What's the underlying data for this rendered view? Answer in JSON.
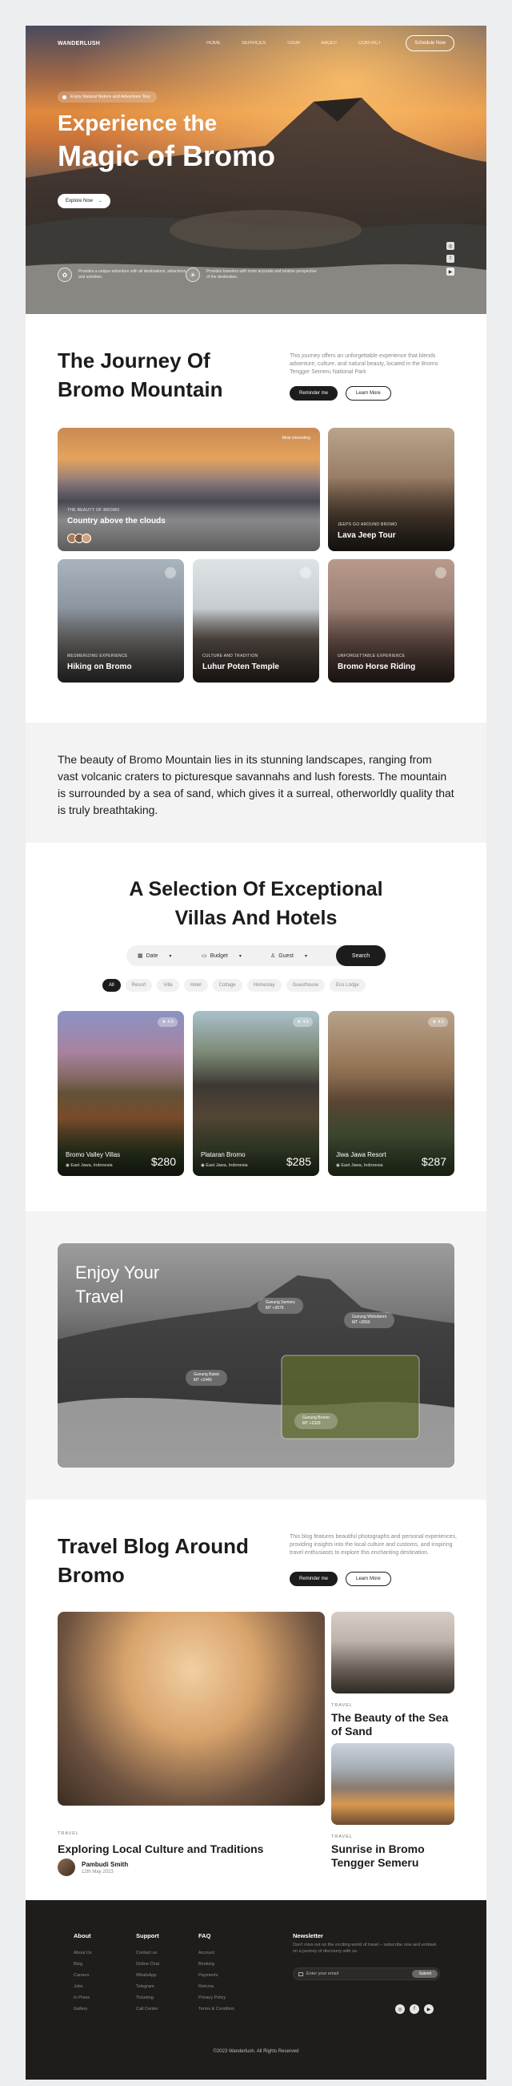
{
  "nav": {
    "logo": "WANDERLUSH",
    "links": [
      "HOME",
      "SERVICES",
      "TOUR",
      "ABOUT",
      "CONTACT"
    ],
    "cta": "Schedule Now"
  },
  "hero": {
    "badge": "Enjoy Natural Nature and Adventure Tour",
    "title_line1": "Experience the",
    "title_line2": "Magic of Bromo",
    "explore": "Explore Now",
    "features": [
      {
        "icon": "leaf-icon",
        "text": "Provides a unique adventure with all destinations, attractions, and activities."
      },
      {
        "icon": "sun-icon",
        "text": "Provides travelers with more accurate and relative perspective of the destination."
      }
    ]
  },
  "journey": {
    "title": "The Journey Of Bromo Mountain",
    "description": "This journey offers an unforgettable experience that blends adventure, culture, and natural beauty, located in the Bromo Tengger Semeru National Park",
    "btn_primary": "Reminder me",
    "btn_secondary": "Learn More",
    "cards": [
      {
        "kicker": "THE BEAUTY OF BROMO",
        "title": "Country above the clouds",
        "tag": "Most interesting"
      },
      {
        "kicker": "JEEPS GO AROUND BROMO",
        "title": "Lava Jeep Tour"
      },
      {
        "kicker": "MESMERIZING EXPERIENCE",
        "title": "Hiking on Bromo"
      },
      {
        "kicker": "CULTURE AND TRADITION",
        "title": "Luhur Poten Temple"
      },
      {
        "kicker": "UNFORGETTABLE EXPERIENCE",
        "title": "Bromo Horse Riding"
      }
    ]
  },
  "quote": {
    "text": "The beauty of Bromo Mountain lies in its stunning landscapes, ranging from vast volcanic craters to picturesque savannahs and lush forests. The mountain is surrounded by a sea of sand, which gives it a surreal, otherworldly quality that is truly breathtaking."
  },
  "villas": {
    "title_line1": "A Selection Of Exceptional",
    "title_line2": "Villas And Hotels",
    "search": {
      "date": "Date",
      "budget": "Budget",
      "guest": "Guest",
      "button": "Search"
    },
    "filters": [
      "All",
      "Resort",
      "Villa",
      "Hotel",
      "Cottage",
      "Homestay",
      "Guesthouse",
      "Eco Lodge"
    ],
    "cards": [
      {
        "name": "Bromo Valley Villas",
        "location": "East Jawa, Indonesia",
        "price": "$280",
        "rating": "4.5"
      },
      {
        "name": "Plataran Bromo",
        "location": "East Jawa, Indonesia",
        "price": "$285",
        "rating": "4.5"
      },
      {
        "name": "Jiwa Jawa Resort",
        "location": "East Jawa, Indonesia",
        "price": "$287",
        "rating": "4.5"
      }
    ]
  },
  "enjoy": {
    "title_line1": "Enjoy Your",
    "title_line2": "Travel",
    "pins": [
      {
        "name": "Gunung Semeru",
        "height": "MT +3676"
      },
      {
        "name": "Gunung Widodaren",
        "height": "MT +2650"
      },
      {
        "name": "Gunung Batok",
        "height": "MT +2440"
      },
      {
        "name": "Gunung Bromo",
        "height": "MT +2329"
      }
    ]
  },
  "blog": {
    "title": "Travel Blog Around Bromo",
    "description": "This blog features beautiful photographs and personal experiences, providing insights into the local culture and customs, and inspiring travel enthusiasts to explore this enchanting destination.",
    "btn_primary": "Reminder me",
    "btn_secondary": "Learn More",
    "main": {
      "kicker": "TRAVEL",
      "title": "Exploring Local Culture and Traditions",
      "author": "Pambudi Smith",
      "date": "12th May 2023"
    },
    "side": [
      {
        "kicker": "TRAVEL",
        "title": "The Beauty of the Sea of Sand"
      },
      {
        "kicker": "TRAVEL",
        "title": "Sunrise in Bromo Tengger Semeru"
      }
    ]
  },
  "footer": {
    "columns": [
      {
        "heading": "About",
        "items": [
          "About Us",
          "Blog",
          "Careers",
          "Jobs",
          "In Press",
          "Gallery"
        ]
      },
      {
        "heading": "Support",
        "items": [
          "Contact us",
          "Online Chat",
          "WhatsApp",
          "Telegram",
          "Ticketing",
          "Call Center"
        ]
      },
      {
        "heading": "FAQ",
        "items": [
          "Account",
          "Booking",
          "Payments",
          "Returns",
          "Privacy Policy",
          "Terms & Condition"
        ]
      }
    ],
    "newsletter": {
      "heading": "Newsletter",
      "description": "Don't miss out on the exciting world of travel – subscribe now and embark on a journey of discovery with us.",
      "placeholder": "Enter your email",
      "button": "Submit"
    },
    "copyright": "©2023 Wanderlush. All Rights Reserved"
  }
}
